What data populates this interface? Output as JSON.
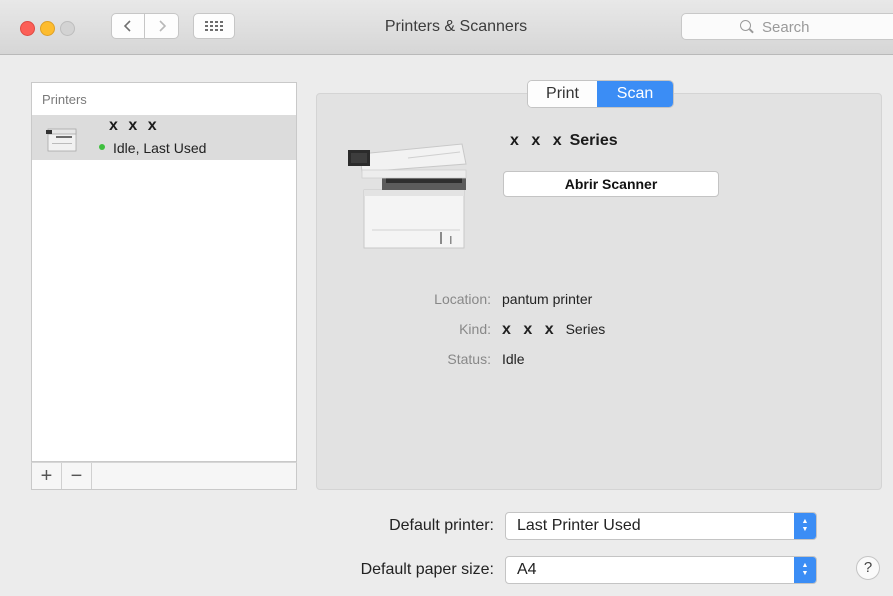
{
  "window": {
    "title": "Printers & Scanners"
  },
  "toolbar": {
    "back_icon": "chevron-left-icon",
    "forward_icon": "chevron-right-icon",
    "grid_icon": "grid-icon",
    "search_placeholder": "Search"
  },
  "printers": {
    "header": "Printers",
    "items": [
      {
        "name": "x x x",
        "status": "Idle, Last Used",
        "status_color": "#3ebf3e"
      }
    ],
    "add_label": "+",
    "remove_label": "−"
  },
  "detail": {
    "tabs": [
      {
        "label": "Print",
        "selected": false
      },
      {
        "label": "Scan",
        "selected": true
      }
    ],
    "device_masked": "x x x",
    "device_series": "Series",
    "open_scanner_label": "Abrir Scanner",
    "info": [
      {
        "label": "Location:",
        "value": "pantum printer"
      },
      {
        "label": "Kind:",
        "masked": "x x x",
        "value": "Series"
      },
      {
        "label": "Status:",
        "value": "Idle"
      }
    ]
  },
  "defaults": {
    "printer_label": "Default printer:",
    "printer_value": "Last Printer Used",
    "paper_label": "Default paper size:",
    "paper_value": "A4"
  },
  "help_label": "?",
  "colors": {
    "accent": "#3b8df5",
    "selection": "#dcdcdc"
  }
}
